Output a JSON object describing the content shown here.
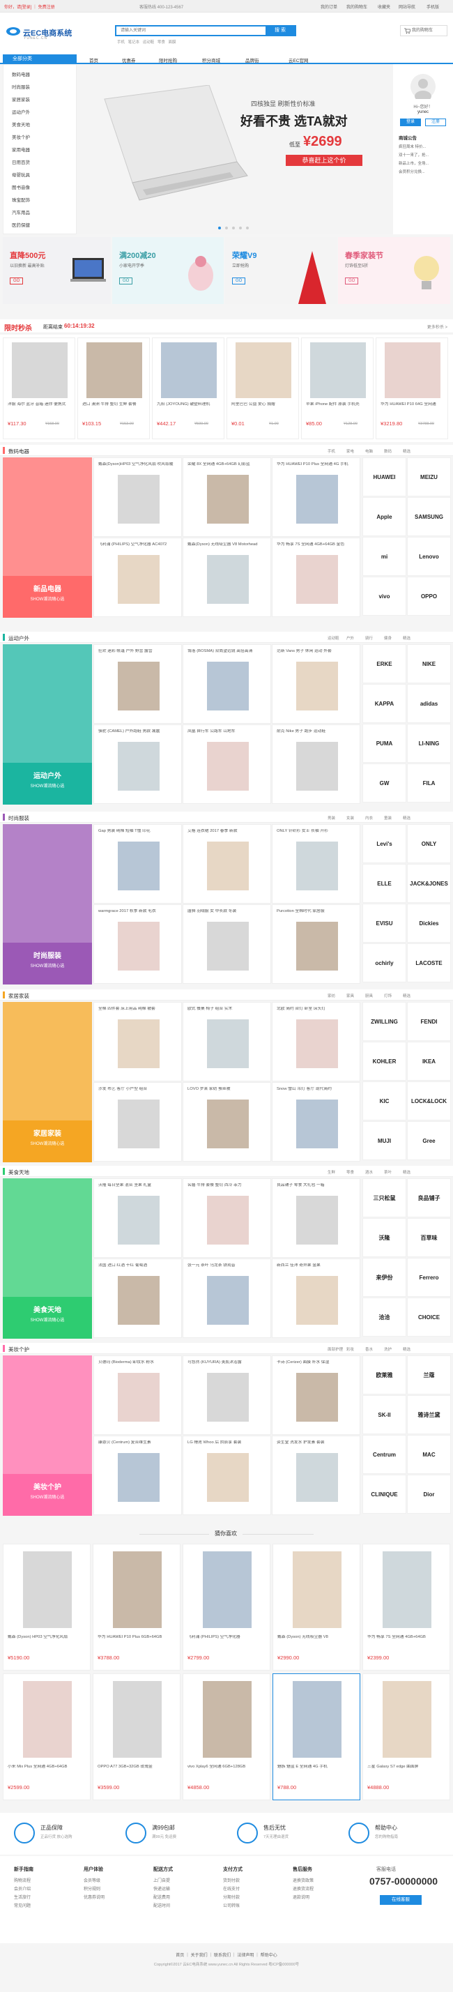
{
  "topbar": {
    "left": "你好，请[登录] ｜ 免费注册",
    "phone": "客服热线 400-123-4567",
    "right_links": [
      "我的订单",
      "我的购物车",
      "收藏夹",
      "网站导航",
      "手机版"
    ]
  },
  "header": {
    "logo_text": "云EC电商系统",
    "logo_sub": "YUNEC.CN",
    "search_placeholder": "请输入关键词",
    "search_btn": "搜 索",
    "hot_words": [
      "手机",
      "笔记本",
      "运动鞋",
      "零食",
      "面膜"
    ],
    "cart": "我的购物车"
  },
  "nav": {
    "all_cat": "全部分类",
    "items": [
      "首页",
      "优惠券",
      "限时抢购",
      "积分商城",
      "品牌街",
      "云EC官网"
    ]
  },
  "categories": [
    "数码电器",
    "时尚服装",
    "家居家装",
    "运动户外",
    "美食天地",
    "美妆个护",
    "家用电器",
    "日用百货",
    "母婴玩具",
    "图书音像",
    "珠宝配饰",
    "汽车用品",
    "医药保健"
  ],
  "banner": {
    "line1": "四核独显 刷新性价标准",
    "slogan": "好看不贵 选TA就对",
    "price_label": "低至",
    "price": "¥2699",
    "cta": "恭喜赶上这个价"
  },
  "user": {
    "greeting": "Hi~您好！",
    "name": "yunec",
    "btn_login": "登录",
    "btn_reg": "注册",
    "news_title": "商城公告",
    "news": [
      "疯狂周末 特价...",
      "双十一来了，抢...",
      "新品上市，全场...",
      "会员积分兑换..."
    ]
  },
  "promos": [
    {
      "title": "直降500元",
      "sub": "以旧换新 最高补贴",
      "tag": "GO"
    },
    {
      "title": "满200减20",
      "sub": "小家电开学季",
      "tag": "GO"
    },
    {
      "title": "荣耀V9",
      "sub": "立即抢购",
      "tag": "GO"
    },
    {
      "title": "春季家装节",
      "sub": "灯饰低至5折",
      "tag": "GO"
    }
  ],
  "flash": {
    "title": "限时秒杀",
    "label": "距离结束",
    "countdown": "60:14:19:32",
    "more": "更多秒杀 >",
    "items": [
      {
        "name": "洋服 海尔 蓝牙 音箱 迷你 便携式",
        "price": "¥117.30",
        "old": "¥158.00"
      },
      {
        "name": "进口 澳洲 牛排 整切 生鲜 套餐",
        "price": "¥103.15",
        "old": "¥153.00"
      },
      {
        "name": "九阳 (JOYOUNG) 破壁料理机",
        "price": "¥442.17",
        "old": "¥599.00"
      },
      {
        "name": "阿里巴巴 公益 爱心 捐赠",
        "price": "¥0.01",
        "old": "¥1.00"
      },
      {
        "name": "苹果 iPhone 配件 原装 手机壳",
        "price": "¥85.00",
        "old": "¥128.00"
      },
      {
        "name": "华为 HUAWEI P10 64G 全网通",
        "price": "¥3219.80",
        "old": "¥3788.00"
      }
    ]
  },
  "floors": [
    {
      "id": "digital",
      "name": "数码电器",
      "color": "#ff6a6a",
      "banner_t": "新品电器",
      "banner_s": "SHOW潮流随心选",
      "tabs": [
        "手机",
        "家电",
        "电脑",
        "数码",
        "精选"
      ],
      "items": [
        "戴森(Dyson)HP03 空气净化风扇 吹风取暖",
        "荣耀 8X 全网通 4GB+64GB 幻影蓝",
        "华为 HUAWEI P10 Plus 全网通 4G 手机",
        "飞利浦 (PHILIPS) 空气净化器 AC4072",
        "戴森(Dyson) 无线吸尘器 V8 Motorhead",
        "华为 畅享 7S 全网通 4GB+64GB 金色"
      ],
      "brands": [
        "HUAWEI",
        "MEIZU",
        "Apple",
        "SAMSUNG",
        "mi",
        "Lenovo",
        "vivo",
        "OPPO"
      ]
    },
    {
      "id": "sport",
      "name": "运动户外",
      "color": "#1bb5a0",
      "banner_t": "运动户外",
      "banner_s": "SHOW潮流随心选",
      "tabs": [
        "运动鞋",
        "户外",
        "骑行",
        "健身",
        "精选"
      ],
      "items": [
        "狂欢 迷彩 帐篷 户外 野营 露营",
        "博洛 (BOSMA) 双筒望远镜 高倍高清",
        "范斯 Vans 男子 休闲 运动 外套",
        "骆驼 (CAMEL) 户外跑鞋 男款 减震",
        "凤凰 自行车 公路车 山地车",
        "耐克 Nike 男子 跑步 运动鞋"
      ],
      "brands": [
        "ERKE",
        "NIKE",
        "KAPPA",
        "adidas",
        "PUMA",
        "LI-NING",
        "GW",
        "FILA"
      ]
    },
    {
      "id": "fashion",
      "name": "时尚服装",
      "color": "#9b59b6",
      "banner_t": "时尚服装",
      "banner_s": "SHOW潮流随心选",
      "tabs": [
        "男装",
        "女装",
        "内衣",
        "童装",
        "精选"
      ],
      "items": [
        "Gap 男装 纯棉 短袖 T恤 印花",
        "艾格 连衣裙 2017 春季 新款",
        "ONLY 针织衫 女士 长袖 开衫",
        "warmgrace 2017 秋季 新款 毛衣",
        "唐狮 羽绒服 女 中长款 冬装",
        "Purcotton 全棉时代 家居服"
      ],
      "brands": [
        "Levi's",
        "ONLY",
        "ELLE",
        "JACK&JONES",
        "EVISU",
        "Dickies",
        "ochirly",
        "LACOSTE"
      ]
    },
    {
      "id": "home",
      "name": "家居家装",
      "color": "#f5a623",
      "banner_t": "家居家装",
      "banner_s": "SHOW潮流随心选",
      "tabs": [
        "家纺",
        "家具",
        "厨具",
        "灯饰",
        "精选"
      ],
      "items": [
        "全棉 四件套 床上用品 纯棉 被套",
        "欧式 餐桌 椅子 组合 实木",
        "北欧 简约 台灯 卧室 床头灯",
        "沙发 布艺 客厅 小户型 组合",
        "LOVO 罗莱 家纺 蚕丝被",
        "Snow 雪山 吊灯 客厅 现代简约"
      ],
      "brands": [
        "ZWILLING",
        "FENDI",
        "KOHLER",
        "IKEA",
        "KIC",
        "LOCK&LOCK",
        "MUJI",
        "Gree"
      ]
    },
    {
      "id": "food",
      "name": "美食天地",
      "color": "#2ecc71",
      "banner_t": "美食天地",
      "banner_s": "SHOW潮流随心选",
      "tabs": [
        "生鲜",
        "零食",
        "酒水",
        "茶叶",
        "精选"
      ],
      "items": [
        "沃隆 每日坚果 混合 坚果 礼盒",
        "名膳 牛排 套餐 整切 西冷 菲力",
        "良品铺子 零食 大礼包 一箱",
        "法国 进口 红酒 干红 葡萄酒",
        "张一元 茶叶 乌龙茶 铁观音",
        "新西兰 佳沛 奇异果 金果"
      ],
      "brands": [
        "三只松鼠",
        "良品铺子",
        "沃隆",
        "百草味",
        "来伊份",
        "Ferrero",
        "洽洽",
        "CHOICE"
      ]
    },
    {
      "id": "beauty",
      "name": "美妆个护",
      "color": "#ff6ba8",
      "banner_t": "美妆个护",
      "banner_s": "SHOW潮流随心选",
      "tabs": [
        "面部护理",
        "彩妆",
        "香水",
        "洗护",
        "精选"
      ],
      "items": [
        "贝德玛 (Bioderma) 卸妆水 粉水",
        "可悠然 (KUYURA) 美肌沐浴露",
        "卡诗 (Cerizer) 面膜 补水 保湿",
        "康恩贝 (Centrum) 复合维生素",
        "LG 睡莲 Whoo 后 拱辰享 套装",
        "资生堂 洗发水 护发素 套装"
      ],
      "brands": [
        "欧莱雅",
        "兰蔻",
        "SK-II",
        "雅诗兰黛",
        "Centrum",
        "MAC",
        "CLINIQUE",
        "Dior"
      ]
    }
  ],
  "guess": {
    "title": "猜你喜欢",
    "items": [
      {
        "name": "戴森 (Dyson) HP03 空气净化风扇",
        "price": "¥5190.00"
      },
      {
        "name": "华为 HUAWEI P10 Plus 6GB+64GB",
        "price": "¥3788.00"
      },
      {
        "name": "飞利浦 (PHILIPS) 空气净化器",
        "price": "¥2799.00"
      },
      {
        "name": "戴森 (Dyson) 无线吸尘器 V8",
        "price": "¥2990.00"
      },
      {
        "name": "华为 畅享 7S 全网通 4GB+64GB",
        "price": "¥2399.00"
      },
      {
        "name": "小米 Mix Plus 全网通 4GB+64GB",
        "price": "¥2599.00"
      },
      {
        "name": "OPPO A77 3GB+32GB 玫瑰金",
        "price": "¥3599.00"
      },
      {
        "name": "vivo Xplay6 全网通 6GB+128GB",
        "price": "¥4858.00"
      },
      {
        "name": "魅族 魅蓝 E 全网通 4G 手机",
        "price": "¥788.00"
      },
      {
        "name": "三星 Galaxy S7 edge 曲面屏",
        "price": "¥4888.00"
      }
    ]
  },
  "services": [
    {
      "t": "正品保障",
      "s": "正品行货 放心选购"
    },
    {
      "t": "满99包邮",
      "s": "满99元 免运费"
    },
    {
      "t": "售后无忧",
      "s": "7天无理由退货"
    },
    {
      "t": "帮助中心",
      "s": "您的购物指南"
    }
  ],
  "footer_cols": [
    {
      "h": "新手指南",
      "l": [
        "购物流程",
        "会员介绍",
        "生活旅行",
        "常见问题"
      ]
    },
    {
      "h": "用户体验",
      "l": [
        "会员等级",
        "积分规则",
        "优惠券说明"
      ]
    },
    {
      "h": "配送方式",
      "l": [
        "上门自提",
        "快递运输",
        "配送费用",
        "配送时间"
      ]
    },
    {
      "h": "支付方式",
      "l": [
        "货到付款",
        "在线支付",
        "分期付款",
        "公司转账"
      ]
    },
    {
      "h": "售后服务",
      "l": [
        "退换货政策",
        "退换货流程",
        "退款说明"
      ]
    }
  ],
  "hotline": {
    "label": "客服电话",
    "phone": "0757-00000000",
    "btn": "在线客服"
  },
  "bottom": {
    "links": [
      "首页",
      "关于我们",
      "联系我们",
      "法律声明",
      "帮助中心"
    ],
    "copy": "Copyright©2017 云EC电商系统 www.yunec.cn All Rights Reserved 粤ICP备000000号"
  },
  "colors": {
    "accent": "#1e8be0",
    "price": "#e4393c",
    "flash": "#e4393c"
  }
}
